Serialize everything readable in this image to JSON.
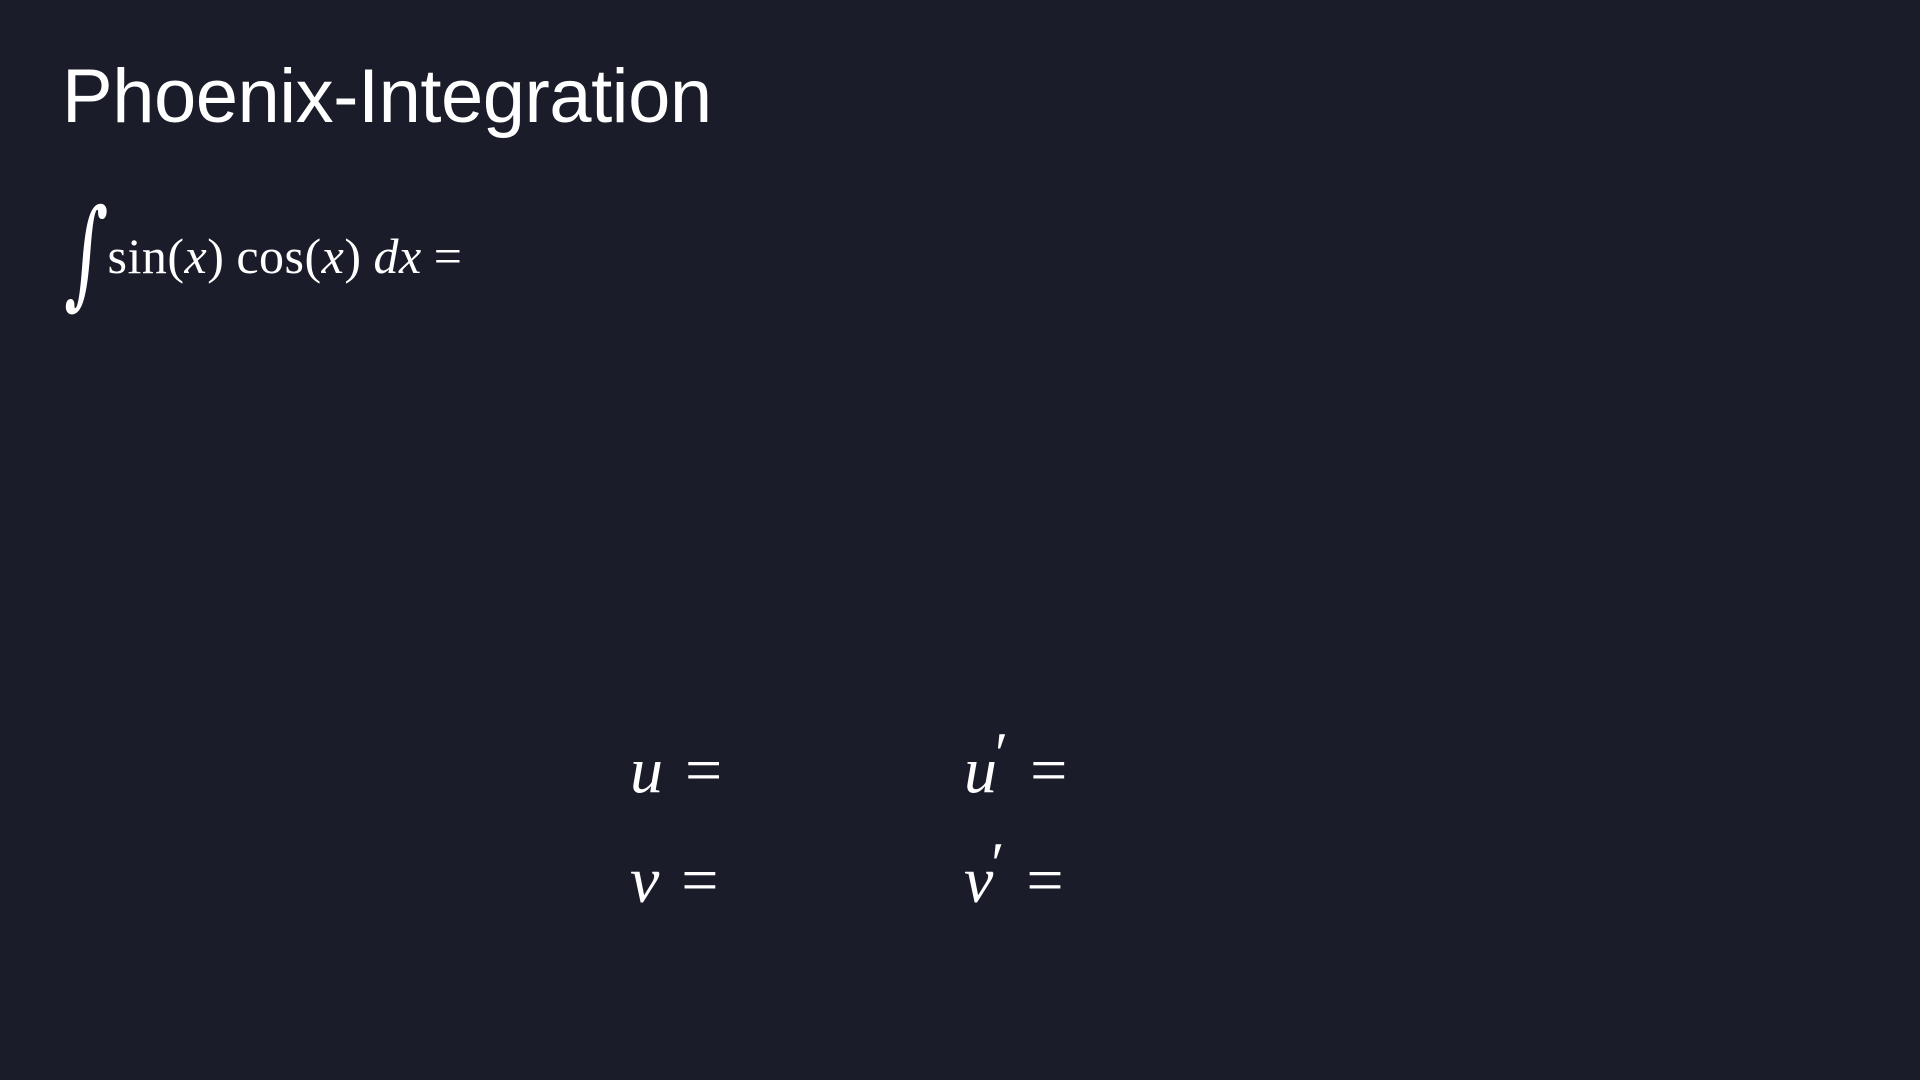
{
  "slide": {
    "title": "Phoenix-Integration",
    "integral": {
      "sign": "∫",
      "func1": "sin",
      "open1": "(",
      "var1": "x",
      "close1": ")",
      "func2": "cos",
      "open2": "(",
      "var2": "x",
      "close2": ")",
      "d": "d",
      "dvar": "x",
      "equals": "="
    },
    "substitution": {
      "u": {
        "var": "u",
        "prime": "",
        "equals": "="
      },
      "v": {
        "var": "v",
        "prime": "",
        "equals": "="
      },
      "u_prime": {
        "var": "u",
        "prime": "′",
        "equals": "="
      },
      "v_prime": {
        "var": "v",
        "prime": "′",
        "equals": "="
      }
    }
  }
}
